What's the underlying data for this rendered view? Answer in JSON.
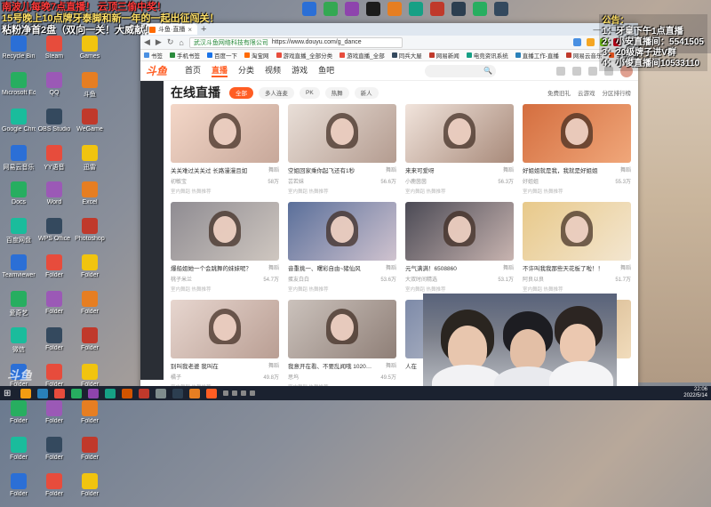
{
  "overlay": {
    "line1": "南波儿每晚7点直播！ 云顶三偷中奖！",
    "line2": "15号晚上10点牌牙泰脚和新一年的一起出征闯关！",
    "line3": "粘粉净首2盘（双向一关！大威献！",
    "notice_title": "公告：",
    "notices": [
      "1：牙皇下午1点直播",
      "2：小安直播间：5541505",
      "3：20级牌子进V群",
      "4：小俊直播间10533110"
    ]
  },
  "browser": {
    "tab_label": "斗鱼·直播",
    "tab_close": "×",
    "tab_add": "+",
    "window_controls": [
      "—",
      "☐",
      "✕"
    ],
    "nav_buttons": [
      "◀",
      "▶",
      "↻",
      "⌂"
    ],
    "url_site": "武汉斗鱼网络科技有限公司",
    "url": "https://www.douyu.com/g_dance",
    "bookmarks": [
      "书签",
      "手机书签",
      "百度一下",
      "淘宝网",
      "游戏直播_全部分类",
      "游戏直播_全部",
      "同兵大屋",
      "网易新闻",
      "电竞资讯系统",
      "直播工作-直播",
      "网易云音乐",
      "斗鱼 - 每个人的直播平台"
    ]
  },
  "douyu": {
    "logo": "斗鱼",
    "nav": [
      "首页",
      "直播",
      "分类",
      "视频",
      "游戏",
      "鱼吧"
    ],
    "active_nav": "直播",
    "search_icon": "search-icon",
    "page_title": "在线直播",
    "filters": [
      "全部",
      "多人连麦",
      "PK",
      "热舞",
      "新人"
    ],
    "title_tools": [
      "免费旧礼",
      "云游戏",
      "分区排行榜"
    ],
    "sidebar": {
      "sections": [
        {
          "title": "",
          "rows": [
            [
              "网易游戏",
              "分鱼专属",
              "DOTA"
            ],
            [
              "王者荣耀",
              "LOL",
              "三国杀"
            ]
          ]
        },
        {
          "title": "手机热游",
          "rows": [
            [
              "全民游戏",
              "卡戏纪元",
              "怀旧游戏"
            ],
            [
              "新游ARA",
              "文分游戏",
              "手游竞技"
            ],
            [
              "火影忍者",
              "网上新人",
              "和平精英"
            ]
          ]
        },
        {
          "title": "手游休闲",
          "rows": [
            [
              "王者荣耀",
              "和平精英",
              "火影忍者"
            ],
            [
              "LOL手游",
              "炉石传说",
              "原神"
            ],
            [
              "COD手游",
              "暗黑破坏神",
              "CF手游"
            ],
            [
              "明日方舟",
              "第五人格",
              "金铲铲之战"
            ],
            [
              "欢乐斗地主",
              "",
              ""
            ],
            [
              "网易游戏",
              "崩坏三",
              "穿越火线"
            ],
            [
              "QQ飞车",
              "",
              "天刀手游"
            ]
          ]
        },
        {
          "title": "娱乐天地",
          "rows": [
            [
              "颜值",
              "",
              "舞蹈"
            ],
            [
              "二次元",
              "户外",
              "音乐"
            ],
            [
              "互动交友",
              "一起看",
              "趣生活"
            ]
          ]
        },
        {
          "title": "科技文化",
          "rows": [
            [
              "科技",
              "",
              ""
            ],
            [
              "社会人文",
              "文化",
              "影视"
            ],
            [
              "汽车",
              "数码",
              ""
            ],
            [
              "鱼教育",
              "鱼秀",
              ""
            ]
          ]
        },
        {
          "title": "游戏分类",
          "rows": []
        }
      ],
      "footer": [
        "客户端打开",
        "投影开播"
      ]
    },
    "cards": [
      {
        "title": "关关难过关关过 长路漫漫且如",
        "cat": "舞蹈",
        "user": "初敏宝",
        "views": "58万",
        "tag": "室内舞蹈 热舞推荐"
      },
      {
        "title": "空姐回家乘你起飞还有1秒",
        "cat": "舞蹈",
        "user": "芸若妹",
        "views": "56.6万",
        "tag": "室内舞蹈 热舞推荐"
      },
      {
        "title": "来来可爱呀",
        "cat": "舞蹈",
        "user": "小鹿茵茵",
        "views": "56.3万",
        "tag": "室内舞蹈 热舞推荐"
      },
      {
        "title": "好姐姐就是我，我就是好姐姐",
        "cat": "舞蹈",
        "user": "好姐姐",
        "views": "55.3万",
        "tag": "室内舞蹈 热舞推荐"
      },
      {
        "title": "爆船姐她一个会跳舞的妹妹呢？",
        "cat": "舞蹈",
        "user": "桃子米兰",
        "views": "54.7万",
        "tag": "室内舞蹈 热舞推荐"
      },
      {
        "title": "音重挑一、曙彩自由~猪仙风",
        "cat": "舞蹈",
        "user": "蛋友白白",
        "views": "53.6万",
        "tag": "室内舞蹈 热舞推荐"
      },
      {
        "title": "元气满满！6508860",
        "cat": "舞蹈",
        "user": "大双时间精选",
        "views": "53.1万",
        "tag": "室内舞蹈 热舞推荐"
      },
      {
        "title": "不许叫我我那些天花板了啦！！",
        "cat": "舞蹈",
        "user": "阿良以良",
        "views": "51.7万",
        "tag": "室内舞蹈 热舞推荐"
      },
      {
        "title": "别叫我老婆 我叫在",
        "cat": "舞蹈",
        "user": "橘子",
        "views": "49.8万",
        "tag": "室内舞蹈 热舞推荐"
      },
      {
        "title": "我意开在看、不要乱闻哦 10204181",
        "cat": "舞蹈",
        "user": "思坞",
        "views": "49.5万",
        "tag": "室内舞蹈 热舞推荐"
      },
      {
        "title": "人在",
        "cat": "",
        "user": "",
        "views": "",
        "tag": ""
      },
      {
        "title": "",
        "cat": "",
        "user": "",
        "views": "",
        "tag": ""
      }
    ]
  },
  "taskbar": {
    "time": "22:06",
    "date": "2022/5/14"
  },
  "watermark": "斗鱼",
  "desktop_labels": [
    "Recycle Bin",
    "Steam",
    "Games",
    "Microsoft Edge",
    "QQ",
    "斗鱼",
    "Google Chrome",
    "OBS Studio",
    "WeGame",
    "网易云音乐",
    "YY语音",
    "迅雷",
    "Docs",
    "Word",
    "Excel",
    "百度网盘",
    "WPS Office",
    "Photoshop",
    "Teamviewer",
    "Folder",
    "Folder",
    "爱奇艺",
    "Folder",
    "Folder",
    "微信",
    "Folder",
    "Folder",
    "Folder",
    "Folder",
    "Folder",
    "Folder",
    "Folder",
    "Folder",
    "Folder",
    "Folder",
    "Folder",
    "Folder",
    "Folder",
    "Folder"
  ],
  "colors": {
    "accent": "#ff5d23",
    "sidebar_bg": "#1f2329"
  }
}
